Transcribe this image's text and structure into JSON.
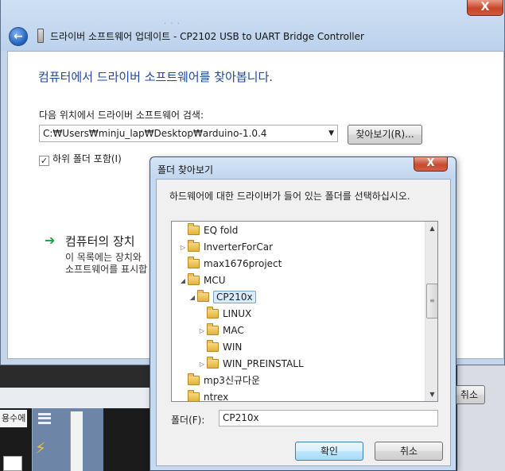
{
  "wizard": {
    "title": "드라이버 소프트웨어 업데이트 - CP2102 USB to UART Bridge Controller",
    "heading": "컴퓨터에서 드라이버 소프트웨어를 찾아봅니다.",
    "search_label": "다음 위치에서 드라이버 소프트웨어 검색:",
    "path_value": "C:₩Users₩minju_lap₩Desktop₩arduino-1.0.4",
    "browse_label": "찾아보기(R)...",
    "include_subfolders_label": "하위 폴더 포함(I)",
    "include_subfolders_checked": true,
    "option_title": "컴퓨터의 장치",
    "option_desc_line1": "이 목록에는 장치와",
    "option_desc_line2": "소프트웨어를 표시합",
    "cancel_label": "취소",
    "close_glyph": "X"
  },
  "dialog": {
    "title": "폴더 찾아보기",
    "close_glyph": "X",
    "instruction": "하드웨어에 대한 드라이버가 들어 있는 폴더를 선택하십시오.",
    "tree": [
      {
        "label": "EQ fold",
        "level": 0,
        "expander": ""
      },
      {
        "label": "InverterForCar",
        "level": 0,
        "expander": "▷"
      },
      {
        "label": "max1676project",
        "level": 0,
        "expander": ""
      },
      {
        "label": "MCU",
        "level": 0,
        "expander": "◢"
      },
      {
        "label": "CP210x",
        "level": 1,
        "expander": "◢",
        "selected": true
      },
      {
        "label": "LINUX",
        "level": 2,
        "expander": ""
      },
      {
        "label": "MAC",
        "level": 2,
        "expander": "▷"
      },
      {
        "label": "WIN",
        "level": 2,
        "expander": ""
      },
      {
        "label": "WIN_PREINSTALL",
        "level": 2,
        "expander": "▷"
      },
      {
        "label": "mp3신규다운",
        "level": 0,
        "expander": ""
      },
      {
        "label": "ntrex",
        "level": 0,
        "expander": ""
      }
    ],
    "folder_label": "폴더(F):",
    "folder_value": "CP210x",
    "ok_label": "확인",
    "cancel_label": "취소"
  },
  "background": {
    "left_tab_text": "용수에"
  }
}
